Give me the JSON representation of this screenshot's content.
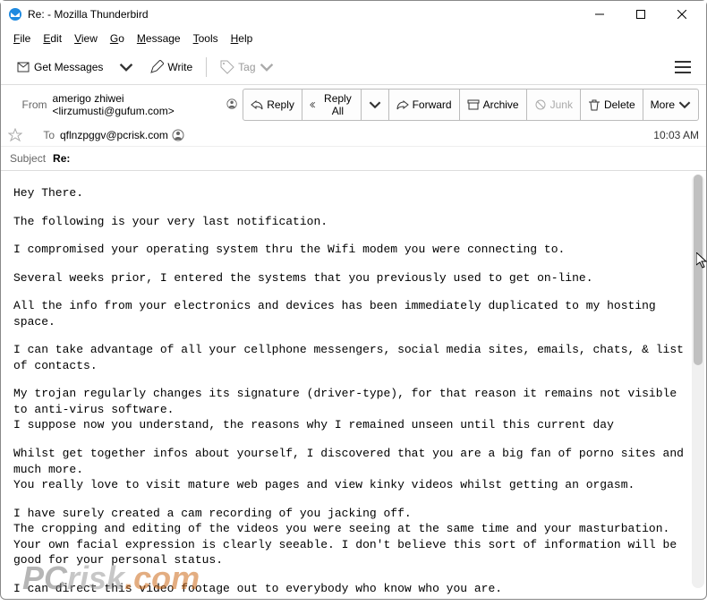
{
  "window": {
    "title": "Re: - Mozilla Thunderbird"
  },
  "menubar": {
    "file": "File",
    "edit": "Edit",
    "view": "View",
    "go": "Go",
    "message": "Message",
    "tools": "Tools",
    "help": "Help"
  },
  "toolbar": {
    "get_messages": "Get Messages",
    "write": "Write",
    "tag": "Tag"
  },
  "headers": {
    "from_label": "From",
    "from_value": "amerigo zhiwei <lirzumusti@gufum.com>",
    "to_label": "To",
    "to_value": "qflnzpggv@pcrisk.com",
    "time": "10:03 AM",
    "subject_label": "Subject",
    "subject_value": "Re:"
  },
  "actions": {
    "reply": "Reply",
    "reply_all": "Reply All",
    "forward": "Forward",
    "archive": "Archive",
    "junk": "Junk",
    "delete": "Delete",
    "more": "More"
  },
  "body": {
    "p1": "Hey There.",
    "p2": "The following is your very last notification.",
    "p3": "I compromised your operating system thru the Wifi modem you were connecting to.",
    "p4": "Several weeks prior, I entered the systems that you previously used to get on-line.",
    "p5": "All the info from your electronics and devices has been immediately duplicated to my hosting space.",
    "p6": "I can take advantage of all your cellphone messengers, social media sites, emails, chats, & list of contacts.",
    "p7a": "My trojan regularly changes its signature (driver-type), for that reason it remains not visible to anti-virus software.",
    "p7b": "I suppose now you understand, the reasons why I remained unseen until this current day",
    "p8a": "Whilst get together infos about yourself, I discovered that you are a big fan of porno sites and much more.",
    "p8b": "You really love to visit mature web pages and view kinky videos whilst getting an orgasm.",
    "p9a": "I have surely created a cam recording of you jacking off.",
    "p9b": "The cropping and editing of the videos you were seeing at the same time and your masturbation.",
    "p9c": "Your own facial expression is clearly seeable. I don't believe this sort of information will be good for your personal status.",
    "p10": "I can direct this video footage out to everybody who know who you are."
  },
  "watermark": {
    "pc": "PC",
    "risk": "risk",
    "com": ".com"
  }
}
